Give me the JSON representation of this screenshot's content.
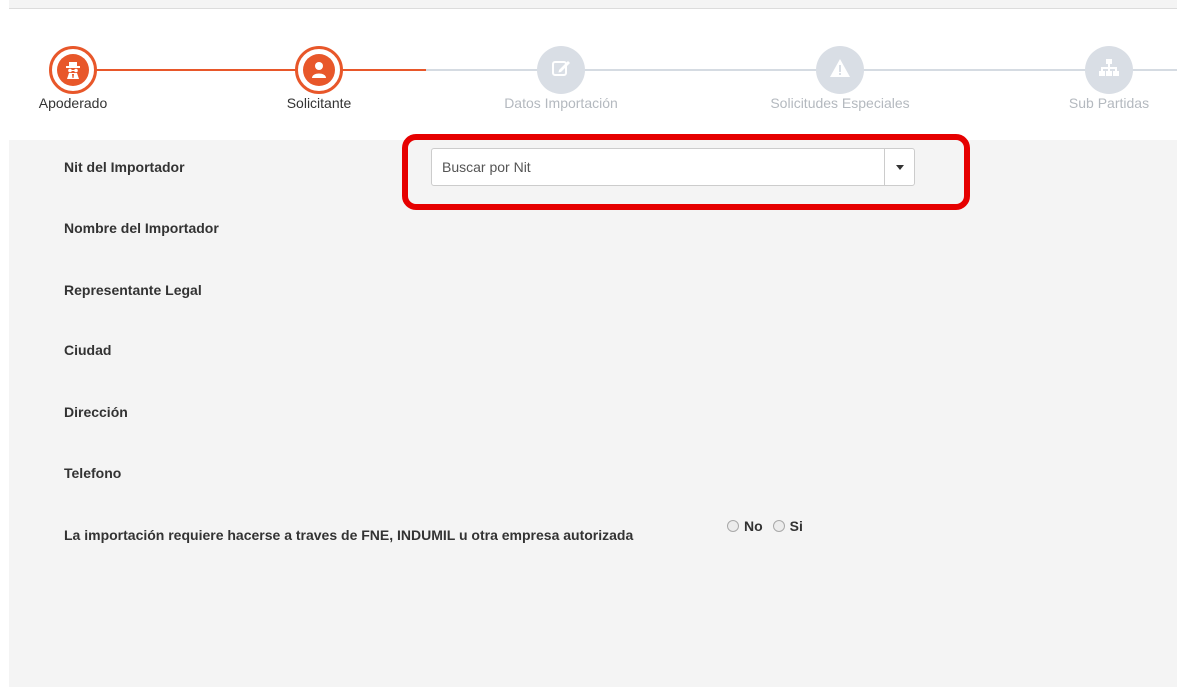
{
  "stepper": {
    "steps": [
      {
        "label": "Apoderado",
        "icon": "spy-icon",
        "state": "active"
      },
      {
        "label": "Solicitante",
        "icon": "user-icon",
        "state": "active"
      },
      {
        "label": "Datos Importación",
        "icon": "edit-icon",
        "state": "inactive"
      },
      {
        "label": "Solicitudes Especiales",
        "icon": "warning-icon",
        "state": "inactive"
      },
      {
        "label": "Sub Partidas",
        "icon": "sitemap-icon",
        "state": "inactive"
      }
    ],
    "accent_color": "#e8572a",
    "inactive_color": "#d9dee5"
  },
  "form": {
    "nit_label": "Nit del Importador",
    "nit_placeholder": "Buscar por Nit",
    "nombre_label": "Nombre del Importador",
    "representante_label": "Representante Legal",
    "ciudad_label": "Ciudad",
    "direccion_label": "Dirección",
    "telefono_label": "Telefono",
    "fne_question": "La importación requiere hacerse a traves de FNE, INDUMIL u otra empresa autorizada",
    "fne_options": [
      "No",
      "Si"
    ]
  },
  "highlight_color": "#e60000"
}
